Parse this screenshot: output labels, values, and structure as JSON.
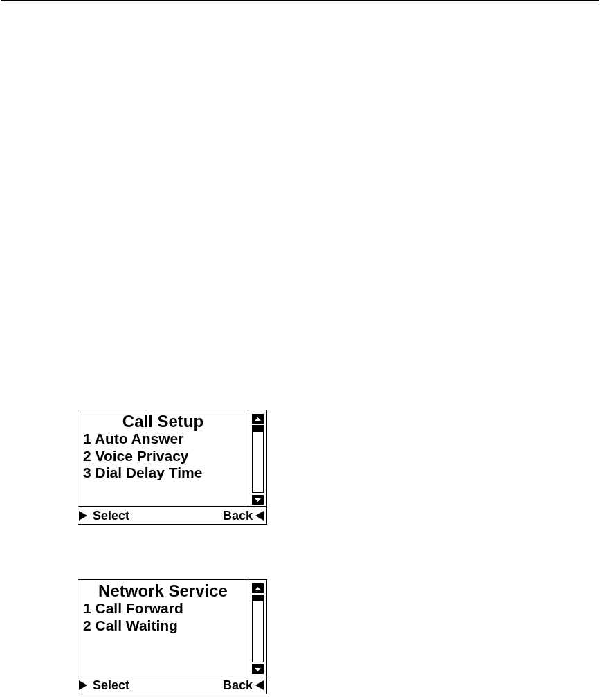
{
  "screens": [
    {
      "title": "Call Setup",
      "items": [
        "1 Auto Answer",
        "2 Voice Privacy",
        "3 Dial Delay Time"
      ],
      "softkeys": {
        "left": "Select",
        "right": "Back"
      }
    },
    {
      "title": "Network Service",
      "items": [
        "1 Call Forward",
        "2 Call Waiting"
      ],
      "softkeys": {
        "left": "Select",
        "right": "Back"
      }
    }
  ]
}
